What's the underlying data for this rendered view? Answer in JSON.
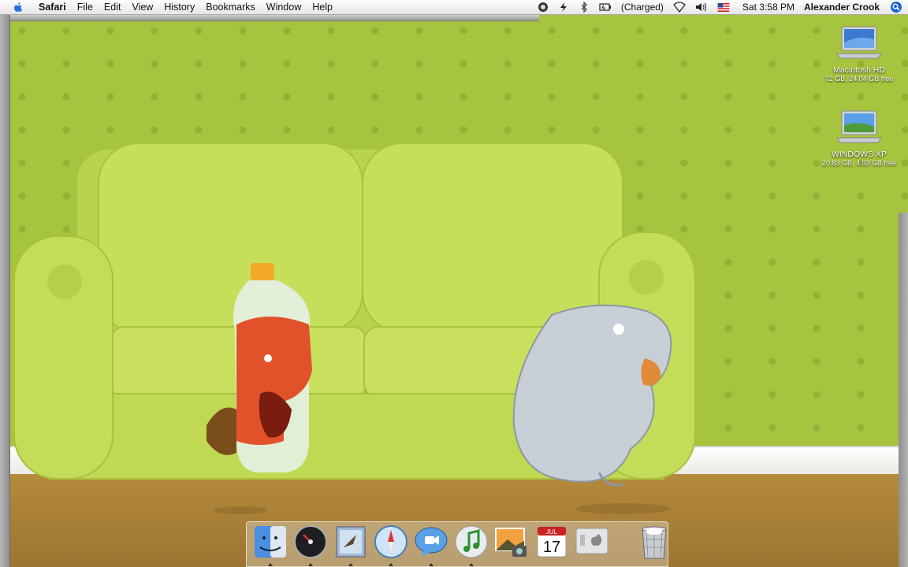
{
  "menubar": {
    "app_name": "Safari",
    "menus": [
      "File",
      "Edit",
      "View",
      "History",
      "Bookmarks",
      "Window",
      "Help"
    ],
    "battery_status": "(Charged)",
    "clock": "Sat 3:58 PM",
    "user_name": "Alexander Crook"
  },
  "desktop": {
    "icons": [
      {
        "name": "Macintosh HD",
        "info": "72 GB, 24.04 GB free"
      },
      {
        "name": "WINDOWS XP",
        "info": "20.83 GB, 4.93 GB free"
      }
    ]
  },
  "dock": {
    "apps": [
      {
        "icon": "finder-icon",
        "running": true
      },
      {
        "icon": "dashboard-icon",
        "running": true
      },
      {
        "icon": "mail-icon",
        "running": true
      },
      {
        "icon": "safari-icon",
        "running": true
      },
      {
        "icon": "ichat-icon",
        "running": true
      },
      {
        "icon": "itunes-icon",
        "running": true
      },
      {
        "icon": "iphoto-icon",
        "running": false
      },
      {
        "icon": "ical-icon",
        "running": false
      },
      {
        "icon": "system-preferences-icon",
        "running": false
      }
    ],
    "ical_month": "JUL",
    "ical_day": "17",
    "trash": {
      "icon": "trash-icon"
    }
  },
  "colors": {
    "wall": "#a6c43e",
    "couch": "#c3dc55",
    "floor": "#b58a3b",
    "highlight": "#1e63d6"
  }
}
